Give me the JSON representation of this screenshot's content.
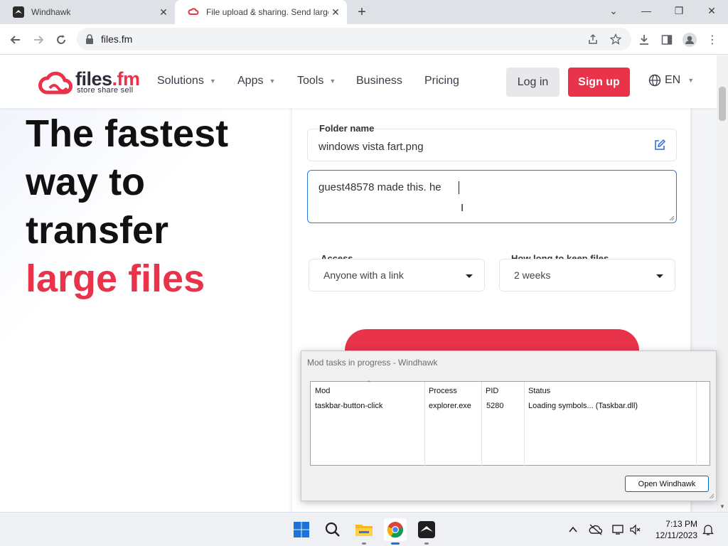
{
  "browser": {
    "tabs": [
      {
        "title": "Windhawk",
        "favicon": "windhawk-icon",
        "active": false
      },
      {
        "title": "File upload & sharing. Send large",
        "favicon": "files-fm-icon",
        "active": true
      }
    ],
    "url": "files.fm"
  },
  "site": {
    "logo_name_main": "files",
    "logo_name_dot": ".fm",
    "logo_tagline": "store  share  sell",
    "nav": [
      {
        "label": "Solutions",
        "dropdown": true
      },
      {
        "label": "Apps",
        "dropdown": true
      },
      {
        "label": "Tools",
        "dropdown": true
      },
      {
        "label": "Business",
        "dropdown": false
      },
      {
        "label": "Pricing",
        "dropdown": false
      }
    ],
    "login_label": "Log in",
    "signup_label": "Sign up",
    "language": "EN",
    "accent_color": "#e8334a"
  },
  "hero": {
    "line1": "The fastest",
    "line2": "way to",
    "line3": "transfer",
    "line4": "large files"
  },
  "form": {
    "folder_label": "Folder name",
    "folder_value": "windows vista fart.png",
    "message_value": "guest48578 made this. he",
    "access_label": "Access",
    "access_value": "Anyone with a link",
    "keep_label": "How long to keep files",
    "keep_value": "2 weeks"
  },
  "dialog": {
    "title": "Mod tasks in progress - Windhawk",
    "columns": [
      "Mod",
      "Process",
      "PID",
      "Status"
    ],
    "rows": [
      {
        "mod": "taskbar-button-click",
        "process": "explorer.exe",
        "pid": "5280",
        "status": "Loading symbols... (Taskbar.dll)"
      }
    ],
    "open_button": "Open Windhawk"
  },
  "taskbar": {
    "apps": [
      "windows-start-icon",
      "search-icon",
      "file-explorer-icon",
      "chrome-icon",
      "windhawk-icon"
    ],
    "time": "7:13 PM",
    "date": "12/11/2023"
  }
}
